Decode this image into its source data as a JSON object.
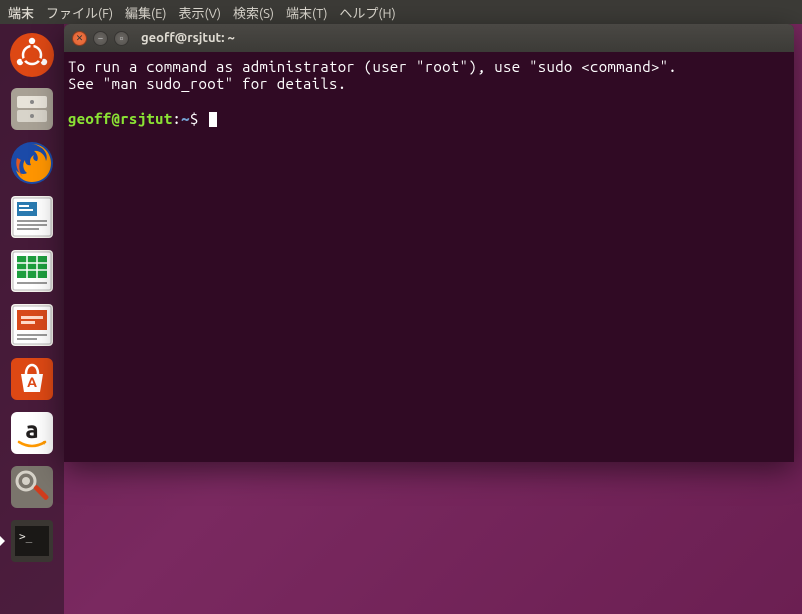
{
  "menubar": {
    "app": "端末",
    "items": [
      "端末",
      "ファイル(F)",
      "編集(E)",
      "表示(V)",
      "検索(S)",
      "端末(T)",
      "ヘルプ(H)"
    ]
  },
  "launcher": {
    "items": [
      {
        "name": "dash-icon",
        "active": false
      },
      {
        "name": "files-icon",
        "active": false
      },
      {
        "name": "firefox-icon",
        "active": false
      },
      {
        "name": "writer-icon",
        "active": false
      },
      {
        "name": "calc-icon",
        "active": false
      },
      {
        "name": "impress-icon",
        "active": false
      },
      {
        "name": "software-center-icon",
        "active": false
      },
      {
        "name": "amazon-icon",
        "active": false
      },
      {
        "name": "settings-icon",
        "active": false
      },
      {
        "name": "terminal-icon",
        "active": true
      }
    ]
  },
  "window": {
    "title": "geoff@rsjtut: ~"
  },
  "terminal": {
    "line1": "To run a command as administrator (user \"root\"), use \"sudo <command>\".",
    "line2": "See \"man sudo_root\" for details.",
    "prompt_user_host": "geoff@rsjtut",
    "prompt_sep": ":",
    "prompt_path": "~",
    "prompt_suffix": "$ "
  }
}
